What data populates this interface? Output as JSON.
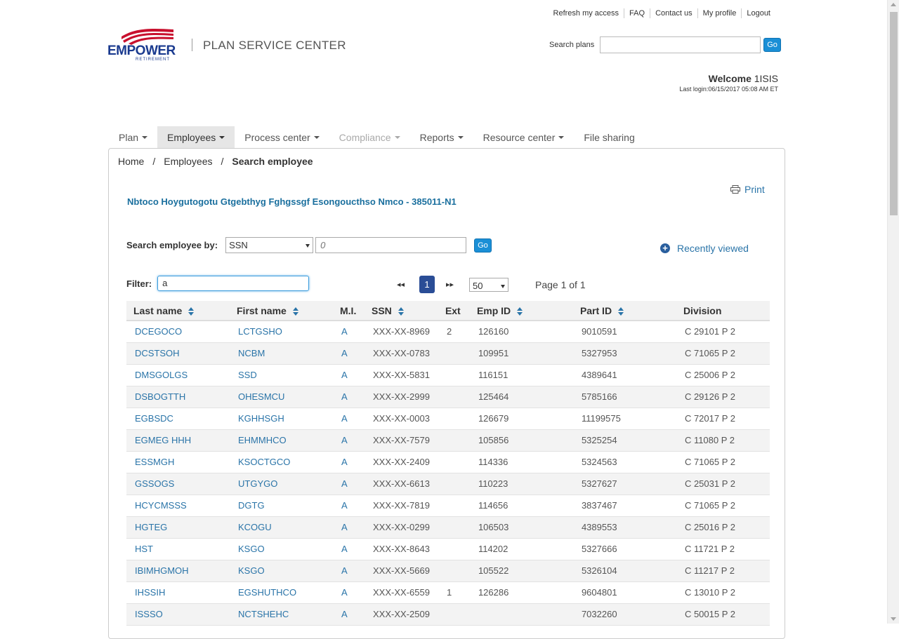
{
  "utility_nav": [
    "Refresh my access",
    "FAQ",
    "Contact us",
    "My profile",
    "Logout"
  ],
  "brand": {
    "logo_text": "EMPOWER",
    "logo_sub": "RETIREMENT",
    "app_title": "PLAN SERVICE CENTER",
    "accent": "#1a3a8f"
  },
  "search_plans": {
    "label": "Search plans",
    "value": "",
    "go": "Go"
  },
  "welcome": {
    "word": "Welcome",
    "user": "1ISIS",
    "last_login": "Last login:06/15/2017 05:08 AM ET"
  },
  "main_nav": [
    {
      "label": "Plan",
      "dropdown": true
    },
    {
      "label": "Employees",
      "dropdown": true,
      "active": true
    },
    {
      "label": "Process center",
      "dropdown": true
    },
    {
      "label": "Compliance",
      "dropdown": true,
      "disabled": true
    },
    {
      "label": "Reports",
      "dropdown": true
    },
    {
      "label": "Resource center",
      "dropdown": true
    },
    {
      "label": "File sharing",
      "dropdown": false
    }
  ],
  "breadcrumb": {
    "home": "Home",
    "sep": "/",
    "section": "Employees",
    "current": "Search employee"
  },
  "print_label": "Print",
  "plan_name": "Nbtoco Hoygutogotu Gtgebthyg Fghgssgf Esongoucthso Nmco - 385011-N1",
  "search_employee": {
    "label": "Search employee by:",
    "selected": "SSN",
    "value": "0",
    "go": "Go"
  },
  "recently_viewed": "Recently viewed",
  "filter": {
    "label": "Filter:",
    "value": "a"
  },
  "pager": {
    "first": "◂◂",
    "next": "▸▸",
    "current": "1",
    "per_page": "50",
    "info": "Page 1 of 1"
  },
  "table": {
    "headers": [
      "Last name",
      "First name",
      "M.I.",
      "SSN",
      "Ext",
      "Emp ID",
      "Part ID",
      "Division"
    ],
    "rows": [
      [
        "DCEGOCO",
        "LCTGSHO",
        "A",
        "XXX-XX-8969",
        "2",
        "126160",
        "9010591",
        "C 29101 P 2"
      ],
      [
        "DCSTSOH",
        "NCBM",
        "A",
        "XXX-XX-0783",
        "",
        "109951",
        "5327953",
        "C 71065 P 2"
      ],
      [
        "DMSGOLGS",
        "SSD",
        "A",
        "XXX-XX-5831",
        "",
        "116151",
        "4389641",
        "C 25006 P 2"
      ],
      [
        "DSBOGTTH",
        "OHESMCU",
        "A",
        "XXX-XX-2999",
        "",
        "125464",
        "5785166",
        "C 29126 P 2"
      ],
      [
        "EGBSDC",
        "KGHHSGH",
        "A",
        "XXX-XX-0003",
        "",
        "126679",
        "11199575",
        "C 72017 P 2"
      ],
      [
        "EGMEG HHH",
        "EHMMHCO",
        "A",
        "XXX-XX-7579",
        "",
        "105856",
        "5325254",
        "C 11080 P 2"
      ],
      [
        "ESSMGH",
        "KSOCTGCO",
        "A",
        "XXX-XX-2409",
        "",
        "114336",
        "5324563",
        "C 71065 P 2"
      ],
      [
        "GSSOGS",
        "UTGYGO",
        "A",
        "XXX-XX-6613",
        "",
        "110223",
        "5327627",
        "C 25031 P 2"
      ],
      [
        "HCYCMSSS",
        "DGTG",
        "A",
        "XXX-XX-7819",
        "",
        "114656",
        "3837467",
        "C 71065 P 2"
      ],
      [
        "HGTEG",
        "KCOGU",
        "A",
        "XXX-XX-0299",
        "",
        "106503",
        "4389553",
        "C 25016 P 2"
      ],
      [
        "HST",
        "KSGO",
        "A",
        "XXX-XX-8643",
        "",
        "114202",
        "5327666",
        "C 11721 P 2"
      ],
      [
        "IBIMHGMOH",
        "KSGO",
        "A",
        "XXX-XX-5669",
        "",
        "105522",
        "5326104",
        "C 11217 P 2"
      ],
      [
        "IHSSIH",
        "EGSHUTHCO",
        "A",
        "XXX-XX-6559",
        "1",
        "126286",
        "9604801",
        "C 13010 P 2"
      ],
      [
        "ISSSO",
        "NCTSHEHC",
        "A",
        "XXX-XX-2509",
        "",
        "",
        "7032260",
        "C 50015 P 2"
      ]
    ]
  }
}
